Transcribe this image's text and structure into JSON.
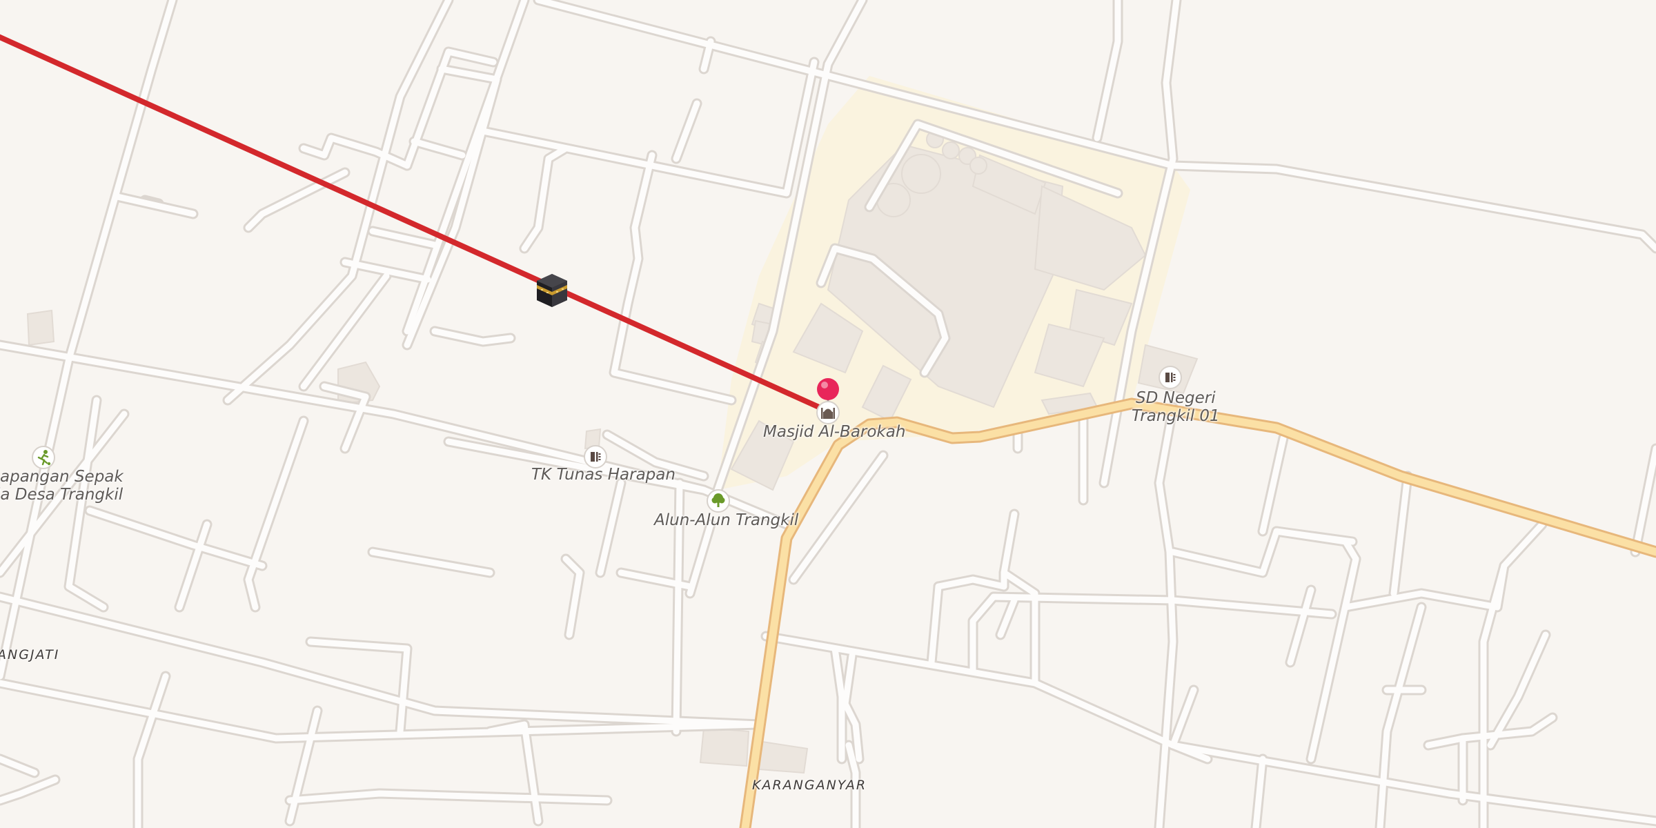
{
  "map": {
    "pois": [
      {
        "id": "masjid",
        "name": "Masjid Al-Barokah",
        "icon": "mosque-icon"
      },
      {
        "id": "sd",
        "name": "SD Negeri Trangkil 01",
        "line1": "SD Negeri",
        "line2": "Trangkil 01",
        "icon": "school-icon"
      },
      {
        "id": "tk",
        "name": "TK Tunas Harapan",
        "icon": "school-icon"
      },
      {
        "id": "alun",
        "name": "Alun-Alun Trangkil",
        "icon": "park-icon"
      },
      {
        "id": "lapangan",
        "line1": "apangan Sepak",
        "line2": "la Desa Trangkil",
        "icon": "soccer-icon"
      }
    ],
    "places": {
      "angjati": "ANGJATI",
      "karanganyar": "KARANGANYAR"
    },
    "qibla": {
      "icon": "kaaba-icon",
      "line_color": "#d3282c"
    },
    "pin_color": "#e8265a"
  }
}
